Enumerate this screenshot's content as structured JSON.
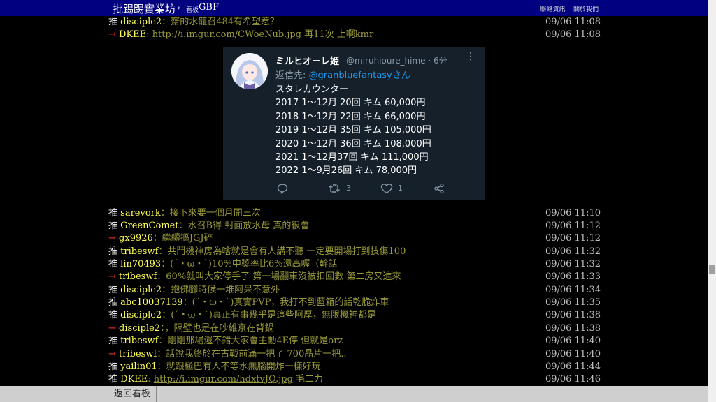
{
  "header": {
    "board_name": "批踢踢實業坊",
    "separator": "›",
    "board_label": "看板",
    "board": "GBF",
    "links": [
      "聯絡資訊",
      "關於我們"
    ]
  },
  "comments_top": [
    {
      "tag": "推",
      "user": "disciple2",
      "text": "：齋的水龍召484有希望惹？",
      "time": "09/06 11:08"
    },
    {
      "tag": "→",
      "user": "DKEE",
      "link": "http://i.imgur.com/CWoeNub.jpg",
      "text": " 再11次 上啊kmr",
      "time": "09/06 11:08"
    }
  ],
  "tweet": {
    "name": "ミルヒオーレ姫",
    "handle": "@miruhioure_hime · 6分",
    "reply_prefix": "返信先: ",
    "reply_mention": "@granbluefantasy",
    "reply_suffix": "さん",
    "lines": [
      "スタレカウンター",
      "2017 1～12月 20回 キム  60,000円",
      "2018 1～12月 22回 キム  66,000円",
      "2019 1～12月 35回 キム 105,000円",
      "2020 1～12月 36回 キム 108,000円",
      "2021  1～12月37回 キム  111,000円",
      "2022  1～9月26回 キム  78,000円"
    ],
    "retweets": "3",
    "likes": "1"
  },
  "comments": [
    {
      "tag": "推",
      "user": "sarevork",
      "text": "：接下來要一個月開三次",
      "time": "09/06 11:10"
    },
    {
      "tag": "推",
      "user": "GreenComet",
      "text": "：水召B得 封面放水母 真的很會",
      "time": "09/06 11:12"
    },
    {
      "tag": "→",
      "user": "gx9926",
      "text": "：繼續摳JGJ碎",
      "time": "09/06 11:12"
    },
    {
      "tag": "推",
      "user": "tribeswf",
      "text": "：共鬥機神房為啥就是會有人講不聽 一定要開場打到技傷100",
      "time": "09/06 11:32"
    },
    {
      "tag": "推",
      "user": "lin70493",
      "text": "：(ˊ・ω・ˋ)10%中獎率比6%還高喔（幹話",
      "time": "09/06 11:32"
    },
    {
      "tag": "→",
      "user": "tribeswf",
      "text": "：60%就叫大家停手了 第一場翻車沒被扣回數 第二房又進來",
      "time": "09/06 11:33"
    },
    {
      "tag": "推",
      "user": "disciple2",
      "text": "：抱佛腳時候一堆阿呆不意外",
      "time": "09/06 11:34"
    },
    {
      "tag": "推",
      "user": "abc10037139",
      "text": "：(ˊ・ω・ˋ)真實PVP，我打不到藍箱的話乾脆炸車",
      "time": "09/06 11:35"
    },
    {
      "tag": "推",
      "user": "disciple2",
      "text": "：(ˊ・ω・ˋ)真正有事幾乎是這些阿厚，無限機神都是",
      "time": "09/06 11:38"
    },
    {
      "tag": "→",
      "user": "disciple2",
      "text": "：，隔壁也是在吵維京在背鍋",
      "time": "09/06 11:38"
    },
    {
      "tag": "推",
      "user": "tribeswf",
      "text": "：剛剛那場還不錯大家會主動4E停 但就是orz",
      "time": "09/06 11:40"
    },
    {
      "tag": "→",
      "user": "tribeswf",
      "text": "：話說我終於在古戰前滿一把了 700晶片一把..",
      "time": "09/06 11:40"
    },
    {
      "tag": "推",
      "user": "yailin01",
      "text": "：就跟極巴有人不等水無腦開炸一樣好玩",
      "time": "09/06 11:44"
    },
    {
      "tag": "推",
      "user": "DKEE",
      "link": "http://i.imgur.com/hdxtvJQ.jpg",
      "text": " 毛二力",
      "time": "09/06 11:46"
    }
  ],
  "footer": {
    "back_label": "返回看板"
  },
  "colors": {
    "header_bg": "#000080",
    "push": "#ffffff",
    "arrow": "#ff3333",
    "user": "#ffff55",
    "text": "#99993a"
  }
}
